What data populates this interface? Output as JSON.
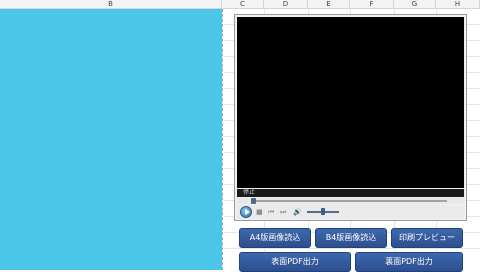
{
  "sheet": {
    "columns": [
      "B",
      "C",
      "D",
      "E",
      "F",
      "G",
      "H"
    ]
  },
  "player": {
    "status_text": "停止",
    "seek_start_marker": "",
    "seek_end_marker": "",
    "icons": [
      "play-icon",
      "stop-icon",
      "previous-icon",
      "next-icon",
      "volume-icon"
    ]
  },
  "buttons": {
    "a4_label": "A4版画像読込",
    "b4_label": "B4版画像読込",
    "preview_label": "印刷プレビュー",
    "front_pdf_label": "表面PDF出力",
    "back_pdf_label": "裏面PDF出力"
  },
  "colors": {
    "column_b_fill": "#4bc6e8",
    "button_fill": "#2f5597",
    "video_background": "#000000"
  }
}
